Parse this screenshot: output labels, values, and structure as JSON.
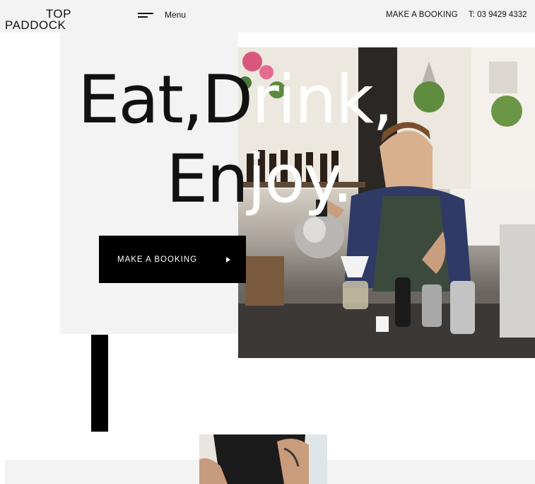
{
  "brand": {
    "logo_line1": "TOP",
    "logo_line2": "PADDOCK"
  },
  "nav": {
    "menu_label": "Menu",
    "booking_label": "MAKE A BOOKING",
    "phone_label": "T: 03 9429 4332"
  },
  "hero": {
    "headline_line1_dark": "Eat,D",
    "headline_line1_light": "rink,",
    "headline_line2_dark": "En",
    "headline_line2_light": "joy.",
    "cta_label": "MAKE A BOOKING"
  },
  "icons": {
    "menu": "hamburger-icon",
    "cta_arrow": "triangle-right-icon"
  },
  "colors": {
    "panel": "#f3f3f3",
    "text": "#111111",
    "cta_bg": "#000000",
    "cta_text": "#ffffff"
  }
}
